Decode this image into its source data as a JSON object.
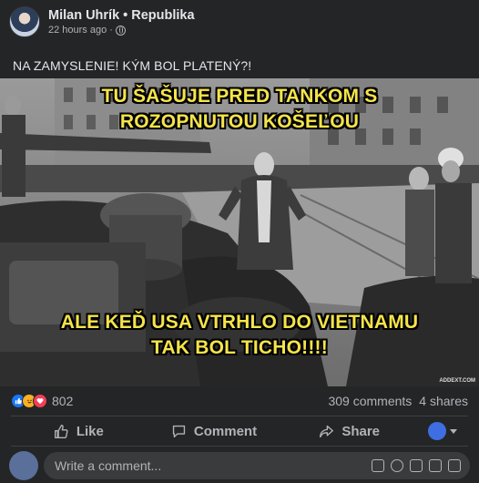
{
  "post": {
    "author": "Milan Uhrík",
    "separator": "•",
    "group": "Republika",
    "time": "22 hours ago",
    "dot": "·",
    "caption": "NA ZAMYSLENIE! KÝM BOL PLATENÝ?!"
  },
  "image": {
    "top_line1": "TU ŠAŠUJE PRED TANKOM S",
    "top_line2": "ROZOPNUTOU KOŠEĽOU",
    "bottom_line1": "ALE KEĎ USA VTRHLO DO VIETNAMU",
    "bottom_line2": "TAK BOL TICHO!!!!",
    "watermark": "ADDEXT.COM"
  },
  "stats": {
    "reaction_count": "802",
    "comments": "309 comments",
    "shares": "4 shares"
  },
  "actions": {
    "like": "Like",
    "comment": "Comment",
    "share": "Share"
  },
  "comment_box": {
    "placeholder": "Write a comment..."
  },
  "colors": {
    "background": "#242526",
    "meme_text": "#f5e44a",
    "like_blue": "#1877f2"
  }
}
